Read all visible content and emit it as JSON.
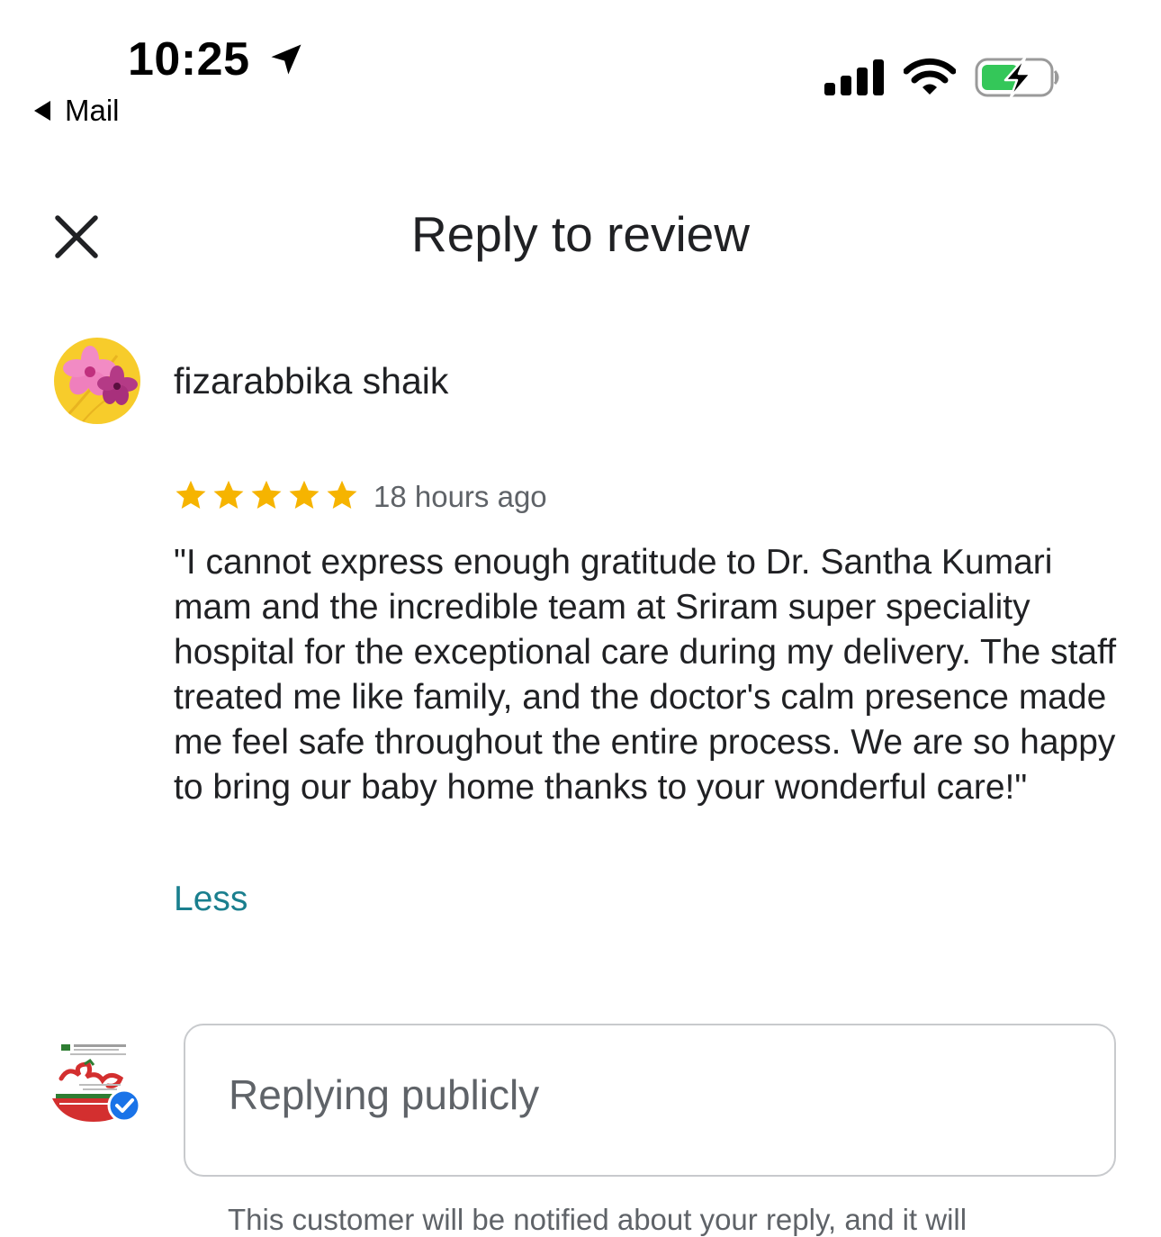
{
  "status_bar": {
    "time": "10:25",
    "back_label": "Mail",
    "icons": [
      "location-arrow-icon",
      "cellular-signal-icon",
      "wifi-icon",
      "battery-charging-icon"
    ]
  },
  "header": {
    "title": "Reply to review",
    "close_icon": "close-icon"
  },
  "review": {
    "reviewer_name": "fizarabbika shaik",
    "rating": 5,
    "rating_max": 5,
    "time_ago": "18 hours ago",
    "text": "\"I cannot express enough gratitude to Dr. Santha Kumari mam and the incredible team at  Sriram super speciality hospital for the exceptional care during my delivery. The staff treated me like family, and the doctor's calm presence made me feel safe throughout the entire process. We are so happy to bring our baby home thanks to your wonderful care!\"",
    "less_label": "Less"
  },
  "reply": {
    "placeholder": "Replying publicly",
    "notice": "This customer will be notified about your reply, and it will"
  },
  "colors": {
    "star": "#f6b400",
    "link": "#1a7f8e",
    "battery_green": "#34c759",
    "verified_blue": "#1a73e8"
  }
}
